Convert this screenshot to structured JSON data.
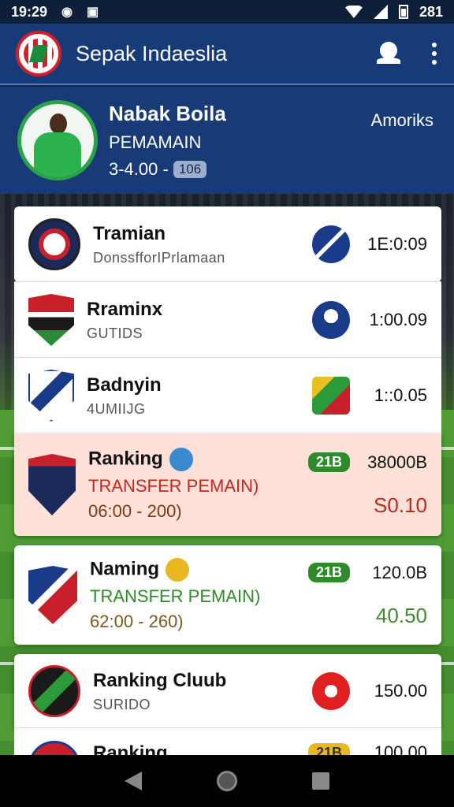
{
  "status_bar": {
    "time": "19:29",
    "battery": "281"
  },
  "app_bar": {
    "title": "Sepak Indaeslia"
  },
  "profile": {
    "name": "Nabak Boila",
    "role": "PEMAMAIN",
    "stats": "3-4.00 -",
    "pill": "106",
    "country": "Amoriks"
  },
  "list": [
    {
      "title": "Tramian",
      "sub": "DonssfforIPrlamaan",
      "value": "1E:0:09"
    },
    {
      "title": "Rraminx",
      "sub": "GUTIDS",
      "value": "1:00.09"
    },
    {
      "title": "Badnyin",
      "sub": "4UMIIJG",
      "value": "1::0.05"
    },
    {
      "title": "Ranking",
      "sub": "TRANSFER PEMAIN)",
      "range": "06:00 - 200)",
      "tag": "21B",
      "value": "38000B",
      "big_value": "S0.10"
    },
    {
      "title": "Naming",
      "sub": "TRANSFER PEMAIN)",
      "range": "62:00 - 260)",
      "tag": "21B",
      "value": "120.0B",
      "big_value": "40.50"
    },
    {
      "title": "Ranking Cluub",
      "sub": "SURIDO",
      "value": "150.00"
    },
    {
      "title": "Ranking",
      "tag": "21B",
      "value": "100.00"
    }
  ],
  "colors": {
    "app_bar": "#173a78",
    "highlight_row": "#fde0d8",
    "tag_green": "#2f8a2b",
    "accent_red": "#c2271f"
  },
  "icons": {
    "status_left": [
      "notification-icon",
      "photo-icon"
    ],
    "status_right": [
      "wifi-icon",
      "signal-icon",
      "battery-icon"
    ],
    "app_bar": [
      "search-icon",
      "more-vert-icon"
    ],
    "nav": [
      "back-icon",
      "home-icon",
      "recents-icon"
    ]
  }
}
